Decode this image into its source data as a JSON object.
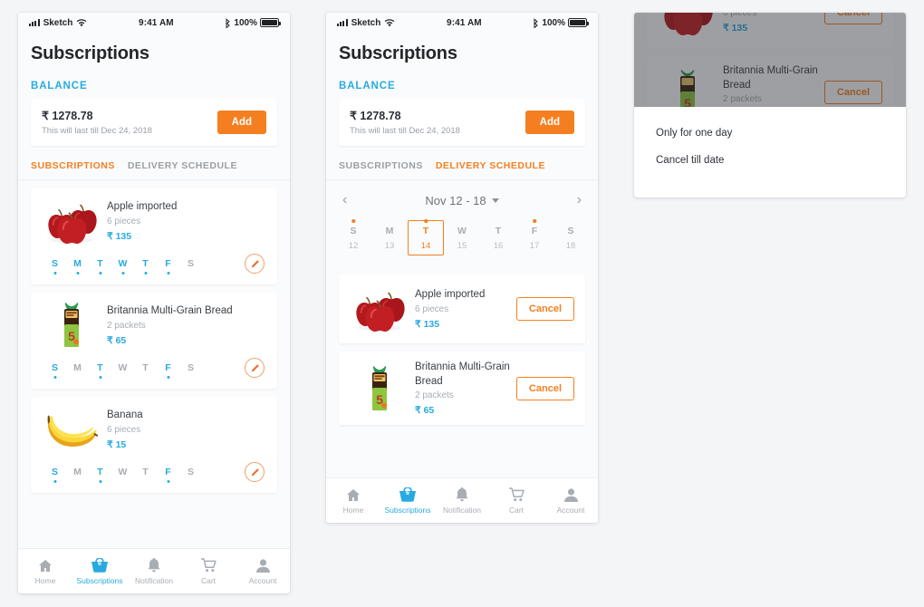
{
  "statusbar": {
    "carrier": "Sketch",
    "time": "9:41 AM",
    "battery_pct": "100%",
    "wifi_icon": "wifi-icon",
    "bluetooth_icon": "bluetooth-icon",
    "signal_icon": "signal-bars-icon",
    "battery_icon": "battery-icon"
  },
  "colors": {
    "accent_orange": "#f57f20",
    "accent_blue": "#27aae1",
    "text_dark": "#2c3036",
    "text_muted": "#a8adb4",
    "page_bg": "#fafbfc"
  },
  "header": {
    "title": "Subscriptions"
  },
  "balance": {
    "section_label": "BALANCE",
    "amount": "₹ 1278.78",
    "note": "This will last till Dec 24, 2018",
    "add_label": "Add"
  },
  "tabs": [
    {
      "label": "SUBSCRIPTIONS",
      "active_on_screen1": true
    },
    {
      "label": "DELIVERY SCHEDULE",
      "active_on_screen1": false
    }
  ],
  "day_letters": [
    "S",
    "M",
    "T",
    "W",
    "T",
    "F",
    "S"
  ],
  "subscriptions": [
    {
      "name": "Apple imported",
      "qty": "6 pieces",
      "price": "₹ 135",
      "thumb": "apples-image",
      "days_active": [
        true,
        true,
        true,
        true,
        true,
        true,
        false
      ],
      "edit_icon": "pencil-icon"
    },
    {
      "name": "Britannia Multi-Grain Bread",
      "qty": "2 packets",
      "price": "₹ 65",
      "thumb": "bread-packet-image",
      "days_active": [
        true,
        false,
        true,
        false,
        false,
        true,
        false
      ],
      "edit_icon": "pencil-icon"
    },
    {
      "name": "Banana",
      "qty": "6 pieces",
      "price": "₹ 15",
      "thumb": "bananas-image",
      "days_active": [
        true,
        false,
        true,
        false,
        false,
        true,
        false
      ],
      "edit_icon": "pencil-icon"
    }
  ],
  "calendar": {
    "range_label": "Nov 12 - 18",
    "prev_icon": "chevron-left-icon",
    "next_icon": "chevron-right-icon",
    "caret_icon": "chevron-down-icon",
    "days": [
      {
        "dow": "S",
        "num": "12",
        "dot": true,
        "selected": false
      },
      {
        "dow": "M",
        "num": "13",
        "dot": false,
        "selected": false
      },
      {
        "dow": "T",
        "num": "14",
        "dot": true,
        "selected": true
      },
      {
        "dow": "W",
        "num": "15",
        "dot": false,
        "selected": false
      },
      {
        "dow": "T",
        "num": "16",
        "dot": false,
        "selected": false
      },
      {
        "dow": "F",
        "num": "17",
        "dot": true,
        "selected": false
      },
      {
        "dow": "S",
        "num": "18",
        "dot": false,
        "selected": false
      }
    ]
  },
  "schedule_items": [
    {
      "name": "Apple imported",
      "qty": "6 pieces",
      "price": "₹ 135",
      "thumb": "apples-image",
      "action_label": "Cancel"
    },
    {
      "name": "Britannia Multi-Grain Bread",
      "qty": "2 packets",
      "price": "₹ 65",
      "thumb": "bread-packet-image",
      "action_label": "Cancel"
    }
  ],
  "bottom_nav": [
    {
      "label": "Home",
      "icon": "home-icon",
      "active": false,
      "badge": ""
    },
    {
      "label": "Subscriptions",
      "icon": "basket-icon",
      "active": true,
      "badge": "6"
    },
    {
      "label": "Notification",
      "icon": "bell-icon",
      "active": false,
      "badge": ""
    },
    {
      "label": "Cart",
      "icon": "cart-icon",
      "active": false,
      "badge": ""
    },
    {
      "label": "Account",
      "icon": "person-icon",
      "active": false,
      "badge": ""
    }
  ],
  "action_sheet": {
    "options": [
      {
        "label": "Only for one day"
      },
      {
        "label": "Cancel till date"
      }
    ]
  }
}
